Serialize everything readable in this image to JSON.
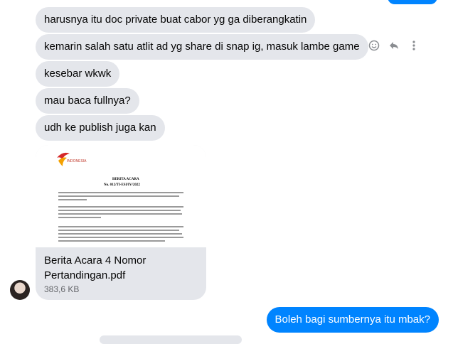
{
  "received_messages": [
    "harusnya itu doc private buat cabor yg ga diberangkatin",
    "kemarin salah satu atlit ad yg share di snap ig, masuk lambe game",
    "kesebar wkwk",
    "mau baca fullnya?",
    "udh ke publish juga kan"
  ],
  "message_actions": [
    "smiley-icon",
    "reply-icon",
    "more-options-icon"
  ],
  "attachment": {
    "preview": {
      "logo_text": "INDONESIA",
      "heading": "BERITA ACARA",
      "number": "No. 012/TI-ESI/IV/2022"
    },
    "file_name_line1": "Berita Acara 4 Nomor",
    "file_name_line2": "Pertandingan.pdf",
    "file_size": "383,6 KB"
  },
  "sent_message": "Boleh bagi sumbernya itu mbak?",
  "colors": {
    "received_bubble": "#e4e6eb",
    "sent_bubble": "#0084ff",
    "text": "#050505"
  }
}
